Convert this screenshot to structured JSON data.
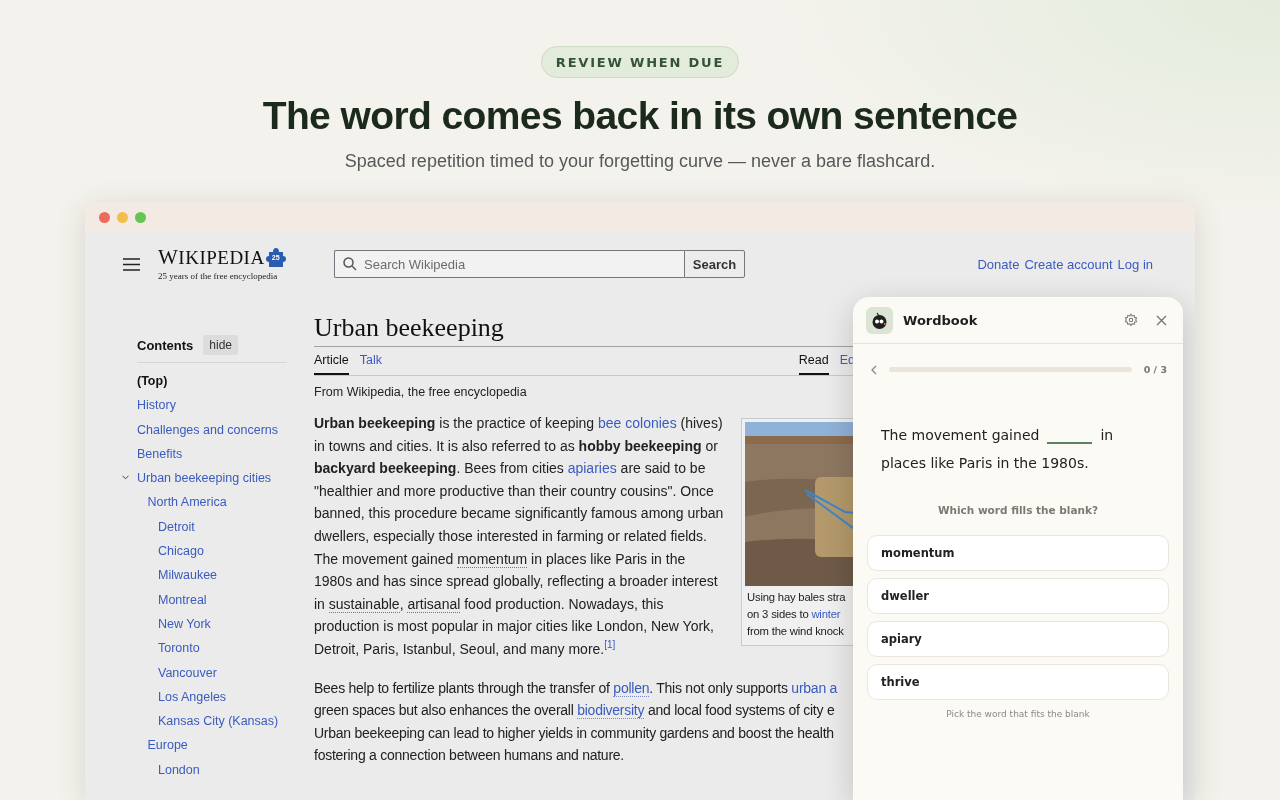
{
  "hero": {
    "badge": "REVIEW WHEN DUE",
    "title": "The word comes back in its own sentence",
    "subtitle": "Spaced repetition timed to your forgetting curve — never a bare flashcard."
  },
  "wiki": {
    "logo": {
      "wordmark": "WIKIPEDIA",
      "badge": "25",
      "tagline": "25 years of the free encyclopedia"
    },
    "search": {
      "placeholder": "Search Wikipedia",
      "button": "Search"
    },
    "links": [
      "Donate",
      "Create account",
      "Log in"
    ],
    "toc": {
      "title": "Contents",
      "hide": "hide",
      "items": [
        {
          "label": "(Top)",
          "selected": true
        },
        {
          "label": "History",
          "selected": false
        },
        {
          "label": "Challenges and concerns",
          "selected": false
        },
        {
          "label": "Benefits",
          "selected": false
        },
        {
          "label": "Urban beekeeping cities",
          "selected": false,
          "expanded": true,
          "children": [
            {
              "label": "North America",
              "selected": false,
              "children": [
                {
                  "label": "Detroit",
                  "selected": false
                },
                {
                  "label": "Chicago",
                  "selected": false
                },
                {
                  "label": "Milwaukee",
                  "selected": false
                },
                {
                  "label": "Montreal",
                  "selected": false
                },
                {
                  "label": "New York",
                  "selected": false
                },
                {
                  "label": "Toronto",
                  "selected": false
                },
                {
                  "label": "Vancouver",
                  "selected": false
                },
                {
                  "label": "Los Angeles",
                  "selected": false
                },
                {
                  "label": "Kansas City (Kansas)",
                  "selected": false
                }
              ]
            },
            {
              "label": "Europe",
              "selected": false,
              "children": [
                {
                  "label": "London",
                  "selected": false
                }
              ]
            }
          ]
        }
      ]
    },
    "article": {
      "title": "Urban beekeeping",
      "tabs": [
        {
          "label": "Article",
          "selected": true
        },
        {
          "label": "Talk",
          "selected": false
        }
      ],
      "views": [
        {
          "label": "Read",
          "selected": true
        },
        {
          "label": "Ed",
          "selected": false
        }
      ],
      "tagline": "From Wikipedia, the free encyclopedia",
      "intro": [
        {
          "kind": "bold",
          "text": "Urban beekeeping"
        },
        {
          "kind": "text",
          "text": " is the practice of keeping "
        },
        {
          "kind": "link",
          "text": "bee colonies"
        },
        {
          "kind": "text",
          "text": " (hives) in towns and cities. It is also referred to as "
        },
        {
          "kind": "bold",
          "text": "hobby beekeeping"
        },
        {
          "kind": "text",
          "text": " or "
        },
        {
          "kind": "bold",
          "text": "backyard beekeeping"
        },
        {
          "kind": "text",
          "text": ". Bees from cities "
        },
        {
          "kind": "link",
          "text": "apiaries"
        },
        {
          "kind": "text",
          "text": " are said to be \"healthier and more productive than their country cousins\". Once banned, this procedure became significantly famous among urban dwellers, especially those interested in farming or related fields. The movement gained "
        },
        {
          "kind": "word",
          "text": "momentum"
        },
        {
          "kind": "text",
          "text": " in places like Paris in the 1980s and has since spread globally, reflecting a broader interest in "
        },
        {
          "kind": "word",
          "text": "sustainable"
        },
        {
          "kind": "text",
          "text": ", "
        },
        {
          "kind": "word",
          "text": "artisanal"
        },
        {
          "kind": "text",
          "text": " food production. Nowadays, this production is most popular in major cities like London, New York, Detroit, Paris, Istanbul, Seoul, and many more."
        },
        {
          "kind": "ref",
          "text": "[1]"
        }
      ],
      "figure": {
        "caption": [
          [
            {
              "kind": "text",
              "text": "Using hay bales stra"
            }
          ],
          [
            {
              "kind": "text",
              "text": "on 3 sides to "
            },
            {
              "kind": "link",
              "text": "winter"
            }
          ],
          [
            {
              "kind": "text",
              "text": "from the wind knock"
            }
          ]
        ]
      },
      "second": [
        [
          {
            "kind": "text",
            "text": "Bees help to fertilize plants through the transfer of "
          },
          {
            "kind": "word-link",
            "text": "pollen"
          },
          {
            "kind": "text",
            "text": ". This not only supports "
          },
          {
            "kind": "link",
            "text": "urban a"
          }
        ],
        [
          {
            "kind": "text",
            "text": "green spaces but also enhances the overall "
          },
          {
            "kind": "word-link",
            "text": "biodiversity"
          },
          {
            "kind": "text",
            "text": " and local food systems of city e"
          }
        ],
        [
          {
            "kind": "text",
            "text": "Urban beekeeping can lead to higher yields in community gardens and boost the health"
          }
        ],
        [
          {
            "kind": "text",
            "text": "fostering a connection between humans and nature."
          }
        ]
      ]
    }
  },
  "panel": {
    "title": "Wordbook",
    "progress": {
      "level": 0,
      "label": "0 / 3"
    },
    "prompt": {
      "before": "The movement gained",
      "after": "in places like Paris in the 1980s."
    },
    "question": "Which word fills the blank?",
    "options": [
      {
        "label": "momentum",
        "selected": false
      },
      {
        "label": "dweller",
        "selected": false
      },
      {
        "label": "apiary",
        "selected": false
      },
      {
        "label": "thrive",
        "selected": false
      }
    ],
    "hint": "Pick the word that fits the blank"
  }
}
